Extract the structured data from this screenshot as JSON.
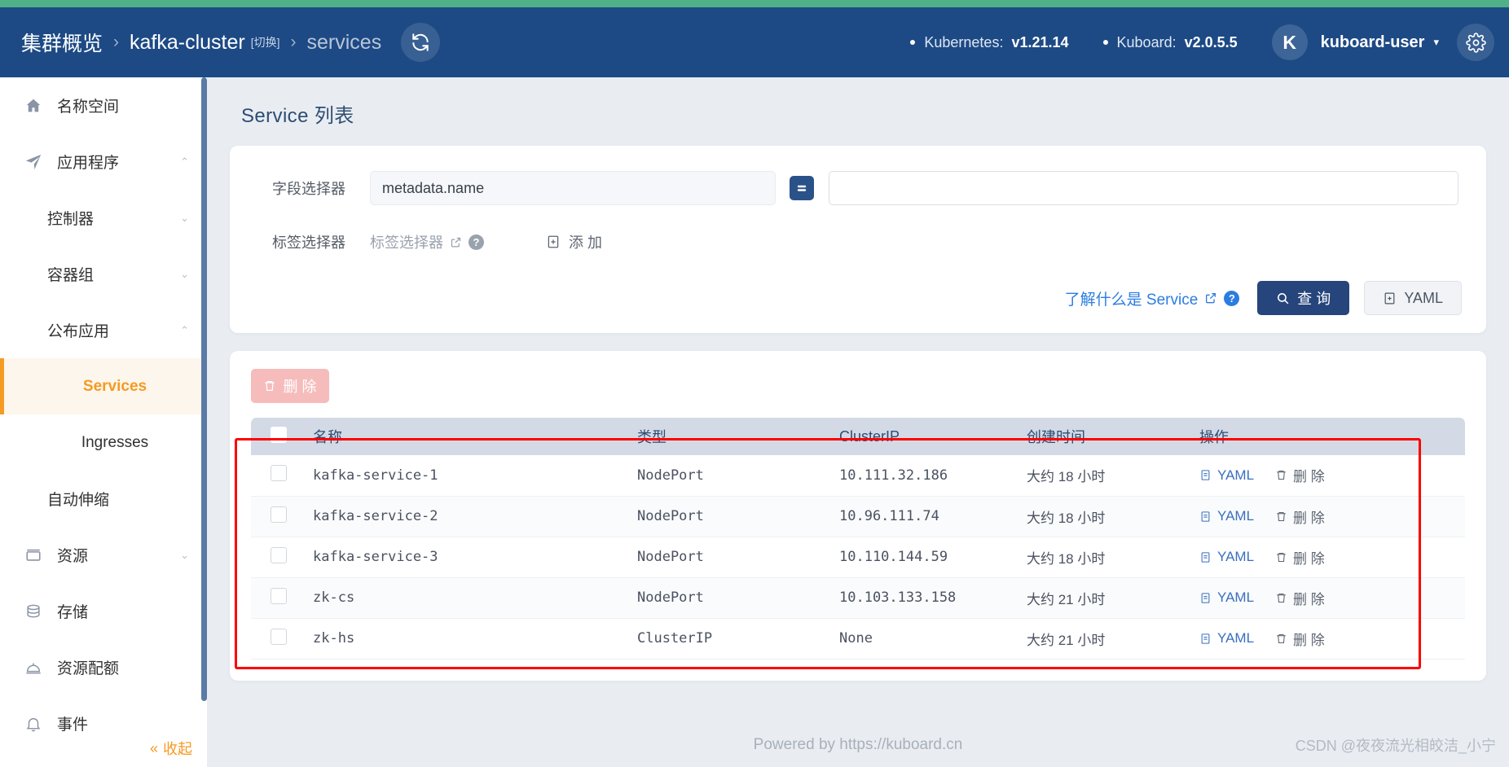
{
  "header": {
    "breadcrumb": [
      {
        "label": "集群概览",
        "dim": false
      },
      {
        "label": "kafka-cluster",
        "dim": false
      },
      {
        "label": "services",
        "dim": true
      }
    ],
    "switch_label": "[切换]",
    "refresh_icon": "refresh-icon",
    "kubernetes_label": "Kubernetes:",
    "kubernetes_version": "v1.21.14",
    "kuboard_label": "Kuboard:",
    "kuboard_version": "v2.0.5.5",
    "avatar_letter": "K",
    "username": "kuboard-user",
    "caret": "▾",
    "gear_icon": "gear-icon",
    "bg_color": "#1d4a85",
    "accent_green": "#4eb188"
  },
  "sidebar": {
    "items": [
      {
        "label": "名称空间",
        "icon": "home-icon",
        "level": "top",
        "chevron": "",
        "active": false
      },
      {
        "label": "应用程序",
        "icon": "send-icon",
        "level": "top",
        "chevron": "⌃",
        "active": false
      },
      {
        "label": "控制器",
        "icon": "",
        "level": "sub",
        "chevron": "⌄",
        "active": false
      },
      {
        "label": "容器组",
        "icon": "",
        "level": "sub",
        "chevron": "⌄",
        "active": false
      },
      {
        "label": "公布应用",
        "icon": "",
        "level": "sub",
        "chevron": "⌃",
        "active": false
      },
      {
        "label": "Services",
        "icon": "",
        "level": "subsub",
        "chevron": "",
        "active": true
      },
      {
        "label": "Ingresses",
        "icon": "",
        "level": "subsub",
        "chevron": "",
        "active": false
      },
      {
        "label": "自动伸缩",
        "icon": "",
        "level": "sub",
        "chevron": "",
        "active": false
      },
      {
        "label": "资源",
        "icon": "box-icon",
        "level": "top",
        "chevron": "⌄",
        "active": false
      },
      {
        "label": "存储",
        "icon": "database-icon",
        "level": "top",
        "chevron": "",
        "active": false
      },
      {
        "label": "资源配额",
        "icon": "bell-dome-icon",
        "level": "top",
        "chevron": "",
        "active": false
      },
      {
        "label": "事件",
        "icon": "bell-icon",
        "level": "top",
        "chevron": "",
        "active": false
      }
    ],
    "collapse_label": "收起",
    "collapse_icon": "double-chevron-left-icon",
    "active_color": "#f59a23"
  },
  "main": {
    "page_title": "Service 列表",
    "filter": {
      "field_selector_label": "字段选择器",
      "field_selector_value": "metadata.name",
      "operator": "=",
      "value_input": "",
      "value_placeholder": "",
      "label_selector_label": "标签选择器",
      "label_selector_link": "标签选择器",
      "external_link_icon": "external-link-icon",
      "help_icon": "help-circle-icon",
      "add_label": "添 加",
      "add_icon": "file-plus-icon",
      "learn_link": "了解什么是 Service",
      "query_label": "查 询",
      "query_icon": "search-icon",
      "yaml_label": "YAML",
      "yaml_icon": "file-icon"
    },
    "table": {
      "delete_button_label": "删 除",
      "delete_icon": "trash-icon",
      "columns": [
        "名称",
        "类型",
        "ClusterIP",
        "创建时间",
        "操作"
      ],
      "rows": [
        {
          "name": "kafka-service-1",
          "type": "NodePort",
          "cluster_ip": "10.111.32.186",
          "created": "大约 18 小时",
          "yaml": "YAML",
          "delete": "删 除"
        },
        {
          "name": "kafka-service-2",
          "type": "NodePort",
          "cluster_ip": "10.96.111.74",
          "created": "大约 18 小时",
          "yaml": "YAML",
          "delete": "删 除"
        },
        {
          "name": "kafka-service-3",
          "type": "NodePort",
          "cluster_ip": "10.110.144.59",
          "created": "大约 18 小时",
          "yaml": "YAML",
          "delete": "删 除"
        },
        {
          "name": "zk-cs",
          "type": "NodePort",
          "cluster_ip": "10.103.133.158",
          "created": "大约 21 小时",
          "yaml": "YAML",
          "delete": "删 除"
        },
        {
          "name": "zk-hs",
          "type": "ClusterIP",
          "cluster_ip": "None",
          "created": "大约 21 小时",
          "yaml": "YAML",
          "delete": "删 除"
        }
      ],
      "highlight_color": "#fe0000"
    }
  },
  "footer": {
    "powered_by": "Powered by https://kuboard.cn",
    "watermark": "CSDN @夜夜流光相皎洁_小宁"
  }
}
